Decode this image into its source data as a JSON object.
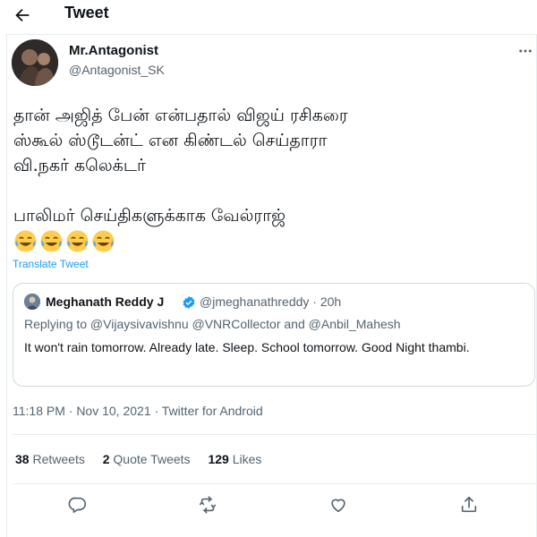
{
  "header": {
    "title": "Tweet"
  },
  "author": {
    "name": "Mr.Antagonist",
    "handle": "@Antagonist_SK"
  },
  "tweet": {
    "lines": [
      "தான் அஜித் பேன் என்பதால் விஜய் ரசிகரை",
      "ஸ்கூல் ஸ்டூடன்ட் என கிண்டல் செய்தாரா",
      "வி.நகர் கலெக்டர்",
      "பாலிமர் செய்திகளுக்காக வேல்ராஜ்"
    ],
    "emojis": [
      "😂",
      "😂",
      "😂",
      "😂"
    ],
    "translate_label": "Translate Tweet"
  },
  "quote": {
    "name": "Meghanath Reddy J",
    "handle_time": "@jmeghanathreddy · 20h",
    "reply_line": "Replying to @Vijaysivavishnu @VNRCollector and @Anbil_Mahesh",
    "text": "It won't rain tomorrow. Already late. Sleep. School tomorrow. Good Night thambi."
  },
  "meta": {
    "timestamp": "11:18 PM · Nov 10, 2021 · Twitter for Android"
  },
  "stats": {
    "retweets_count": "38",
    "retweets_label": "Retweets",
    "quotes_count": "2",
    "quotes_label": "Quote Tweets",
    "likes_count": "129",
    "likes_label": "Likes"
  },
  "icons": {
    "back": "arrow-left-icon",
    "more": "more-horizontal-icon",
    "verified": "verified-badge-icon",
    "reply": "reply-icon",
    "retweet": "retweet-icon",
    "like": "heart-icon",
    "share": "share-icon"
  },
  "colors": {
    "accent": "#1d9bf0",
    "muted": "#536471",
    "text": "#0f1419",
    "border": "#cfd9de"
  }
}
